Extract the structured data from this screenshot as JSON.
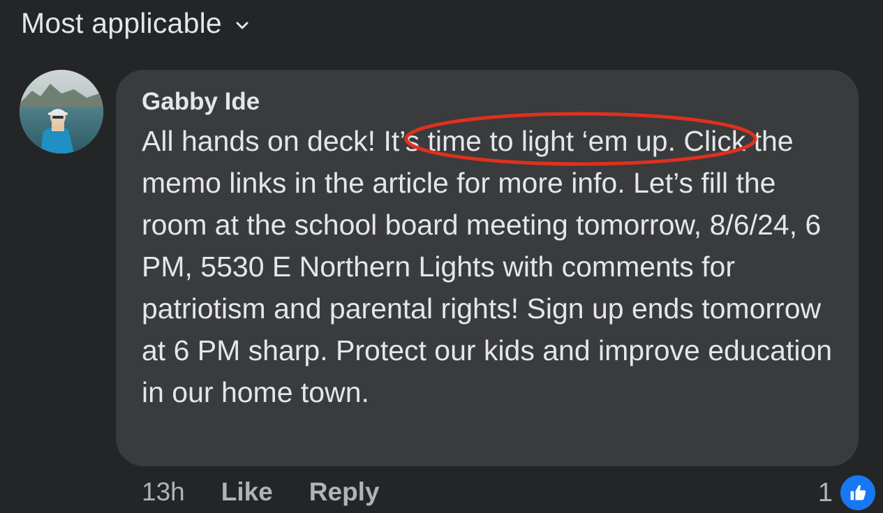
{
  "header": {
    "sort_label": "Most applicable"
  },
  "comment": {
    "author": "Gabby Ide",
    "text_before": "All hands on deck! ",
    "text_highlight": "It’s time to light ‘em up",
    "text_after": ". Click the memo links in the article for more info. Let’s fill the room at the school board meeting tomorrow, 8/6/24, 6 PM, 5530 E Northern Lights with comments for patriotism and parental rights! Sign up ends tomorrow at 6 PM sharp. Protect our kids and improve education in our home town.",
    "annotation_color": "#e0301e"
  },
  "actions": {
    "time": "13h",
    "like_label": "Like",
    "reply_label": "Reply"
  },
  "reactions": {
    "count": "1",
    "icon": "thumbs-up-icon",
    "badge_color": "#1877f2"
  },
  "colors": {
    "background": "#242526",
    "bubble": "#3a3b3c",
    "primary_text": "#e4e6eb",
    "secondary_text": "#b0b3b8"
  }
}
